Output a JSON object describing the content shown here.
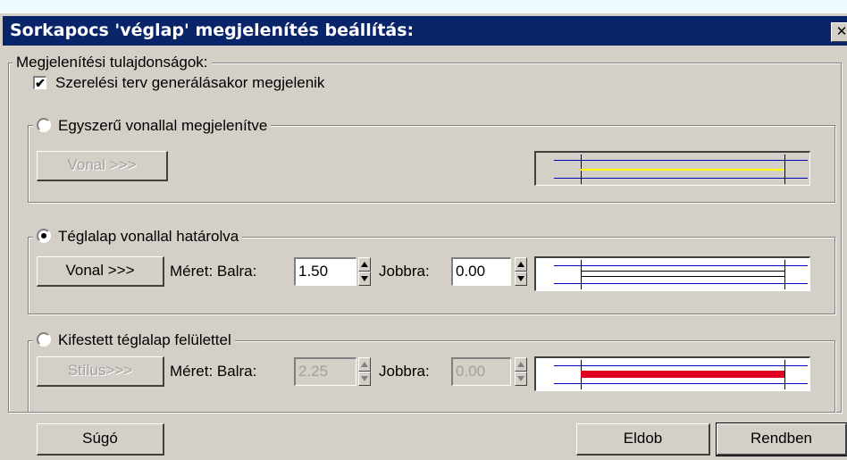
{
  "title": "Sorkapocs 'véglap' megjelenítés beállítás:",
  "close_glyph": "✕",
  "main_group": {
    "label": "Megjelenítési tulajdonságok:"
  },
  "checkbox": {
    "label": "Szerelési terv generálásakor megjelenik",
    "checked": true
  },
  "section1": {
    "label": "Egyszerű vonallal megjelenítve",
    "selected": false,
    "button": "Vonal >>>",
    "button_enabled": false,
    "preview_line_color": "#ffff00"
  },
  "section2": {
    "label": "Téglalap vonallal határolva",
    "selected": true,
    "button": "Vonal >>>",
    "size_label": "Méret: Balra:",
    "left_value": "1.50",
    "right_label": "Jobbra:",
    "right_value": "0.00",
    "preview_line_color": "#000000"
  },
  "section3": {
    "label": "Kifestett téglalap felülettel",
    "selected": false,
    "button": "Stílus>>>",
    "button_enabled": false,
    "size_label": "Méret: Balra:",
    "left_value": "2.25",
    "right_label": "Jobbra:",
    "right_value": "0.00",
    "preview_fill_color": "#e00020"
  },
  "buttons": {
    "help": "Súgó",
    "cancel": "Eldob",
    "ok": "Rendben"
  },
  "colors": {
    "titlebar": "#0a246a",
    "dialog": "#d4d0c8",
    "guide_line": "#0000c0"
  }
}
